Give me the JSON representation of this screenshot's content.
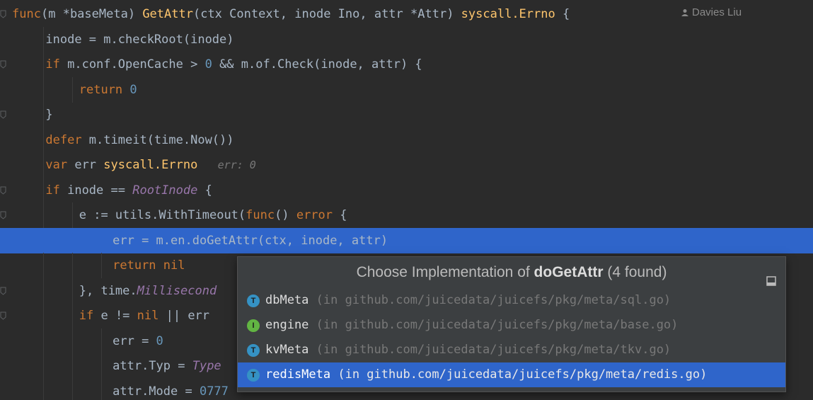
{
  "editor": {
    "lines": [
      {
        "segments": [
          [
            "kw",
            "func"
          ],
          [
            "",
            "("
          ],
          [
            "recv",
            "m"
          ],
          [
            "",
            " "
          ],
          [
            "",
            "*baseMeta"
          ],
          [
            "",
            ") "
          ],
          [
            "fn",
            "GetAttr"
          ],
          [
            "",
            "(ctx Context, inode Ino, attr *Attr) "
          ],
          [
            "fn",
            "syscall.Errno"
          ],
          [
            "",
            " {"
          ]
        ]
      },
      {
        "segments": [
          [
            "",
            "inode = "
          ],
          [
            "",
            "m"
          ],
          [
            "",
            ".checkRoot(inode)"
          ]
        ]
      },
      {
        "segments": [
          [
            "kw",
            "if "
          ],
          [
            "",
            "m"
          ],
          [
            "",
            ".conf.OpenCache > "
          ],
          [
            "num",
            "0"
          ],
          [
            "",
            " && "
          ],
          [
            "",
            "m"
          ],
          [
            "",
            ".of.Check(inode, attr) {"
          ]
        ]
      },
      {
        "segments": [
          [
            "kw",
            "return "
          ],
          [
            "num",
            "0"
          ]
        ]
      },
      {
        "segments": [
          [
            "",
            "}"
          ]
        ]
      },
      {
        "segments": [
          [
            "kw",
            "defer "
          ],
          [
            "",
            "m"
          ],
          [
            "",
            ".timeit(time.Now())"
          ]
        ]
      },
      {
        "segments": [
          [
            "kw",
            "var "
          ],
          [
            "",
            "err "
          ],
          [
            "fn",
            "syscall.Errno"
          ],
          [
            "",
            " "
          ],
          [
            "hint",
            "  err: 0"
          ]
        ]
      },
      {
        "segments": [
          [
            "kw",
            "if "
          ],
          [
            "",
            "inode == "
          ],
          [
            "ital",
            "RootInode"
          ],
          [
            "",
            " {"
          ]
        ]
      },
      {
        "segments": [
          [
            "",
            "e := utils.WithTimeout("
          ],
          [
            "kw",
            "func"
          ],
          [
            "",
            "() "
          ],
          [
            "kw",
            "error"
          ],
          [
            "",
            " {"
          ]
        ]
      },
      {
        "segments": [
          [
            "",
            "err = "
          ],
          [
            "",
            "m"
          ],
          [
            "",
            ".en.doGetAttr(ctx, inode, attr)"
          ]
        ]
      },
      {
        "segments": [
          [
            "kw",
            "return "
          ],
          [
            "kw",
            "nil"
          ]
        ]
      },
      {
        "segments": [
          [
            "",
            "}, time."
          ],
          [
            "ital",
            "Millisecond"
          ]
        ]
      },
      {
        "segments": [
          [
            "kw",
            "if "
          ],
          [
            "",
            "e != "
          ],
          [
            "kw",
            "nil"
          ],
          [
            "",
            " || err"
          ]
        ]
      },
      {
        "segments": [
          [
            "",
            "err = "
          ],
          [
            "num",
            "0"
          ]
        ]
      },
      {
        "segments": [
          [
            "",
            "attr.Typ = "
          ],
          [
            "ital",
            "Type"
          ]
        ]
      },
      {
        "segments": [
          [
            "",
            "attr.Mode = "
          ],
          [
            "num",
            "0777"
          ]
        ]
      }
    ],
    "author": "Davies Liu"
  },
  "popup": {
    "title_prefix": "Choose Implementation of ",
    "title_method": "doGetAttr",
    "title_suffix": " (4 found)",
    "items": [
      {
        "badge": "T",
        "badge_color": "#3592c4",
        "name": "dbMeta",
        "path": " (in github.com/juicedata/juicefs/pkg/meta/sql.go)"
      },
      {
        "badge": "I",
        "badge_color": "#62b543",
        "name": "engine",
        "path": " (in github.com/juicedata/juicefs/pkg/meta/base.go)"
      },
      {
        "badge": "T",
        "badge_color": "#3592c4",
        "name": "kvMeta",
        "path": " (in github.com/juicedata/juicefs/pkg/meta/tkv.go)"
      },
      {
        "badge": "T",
        "badge_color": "#3592c4",
        "name": "redisMeta",
        "path": " (in github.com/juicedata/juicefs/pkg/meta/redis.go)"
      }
    ]
  }
}
